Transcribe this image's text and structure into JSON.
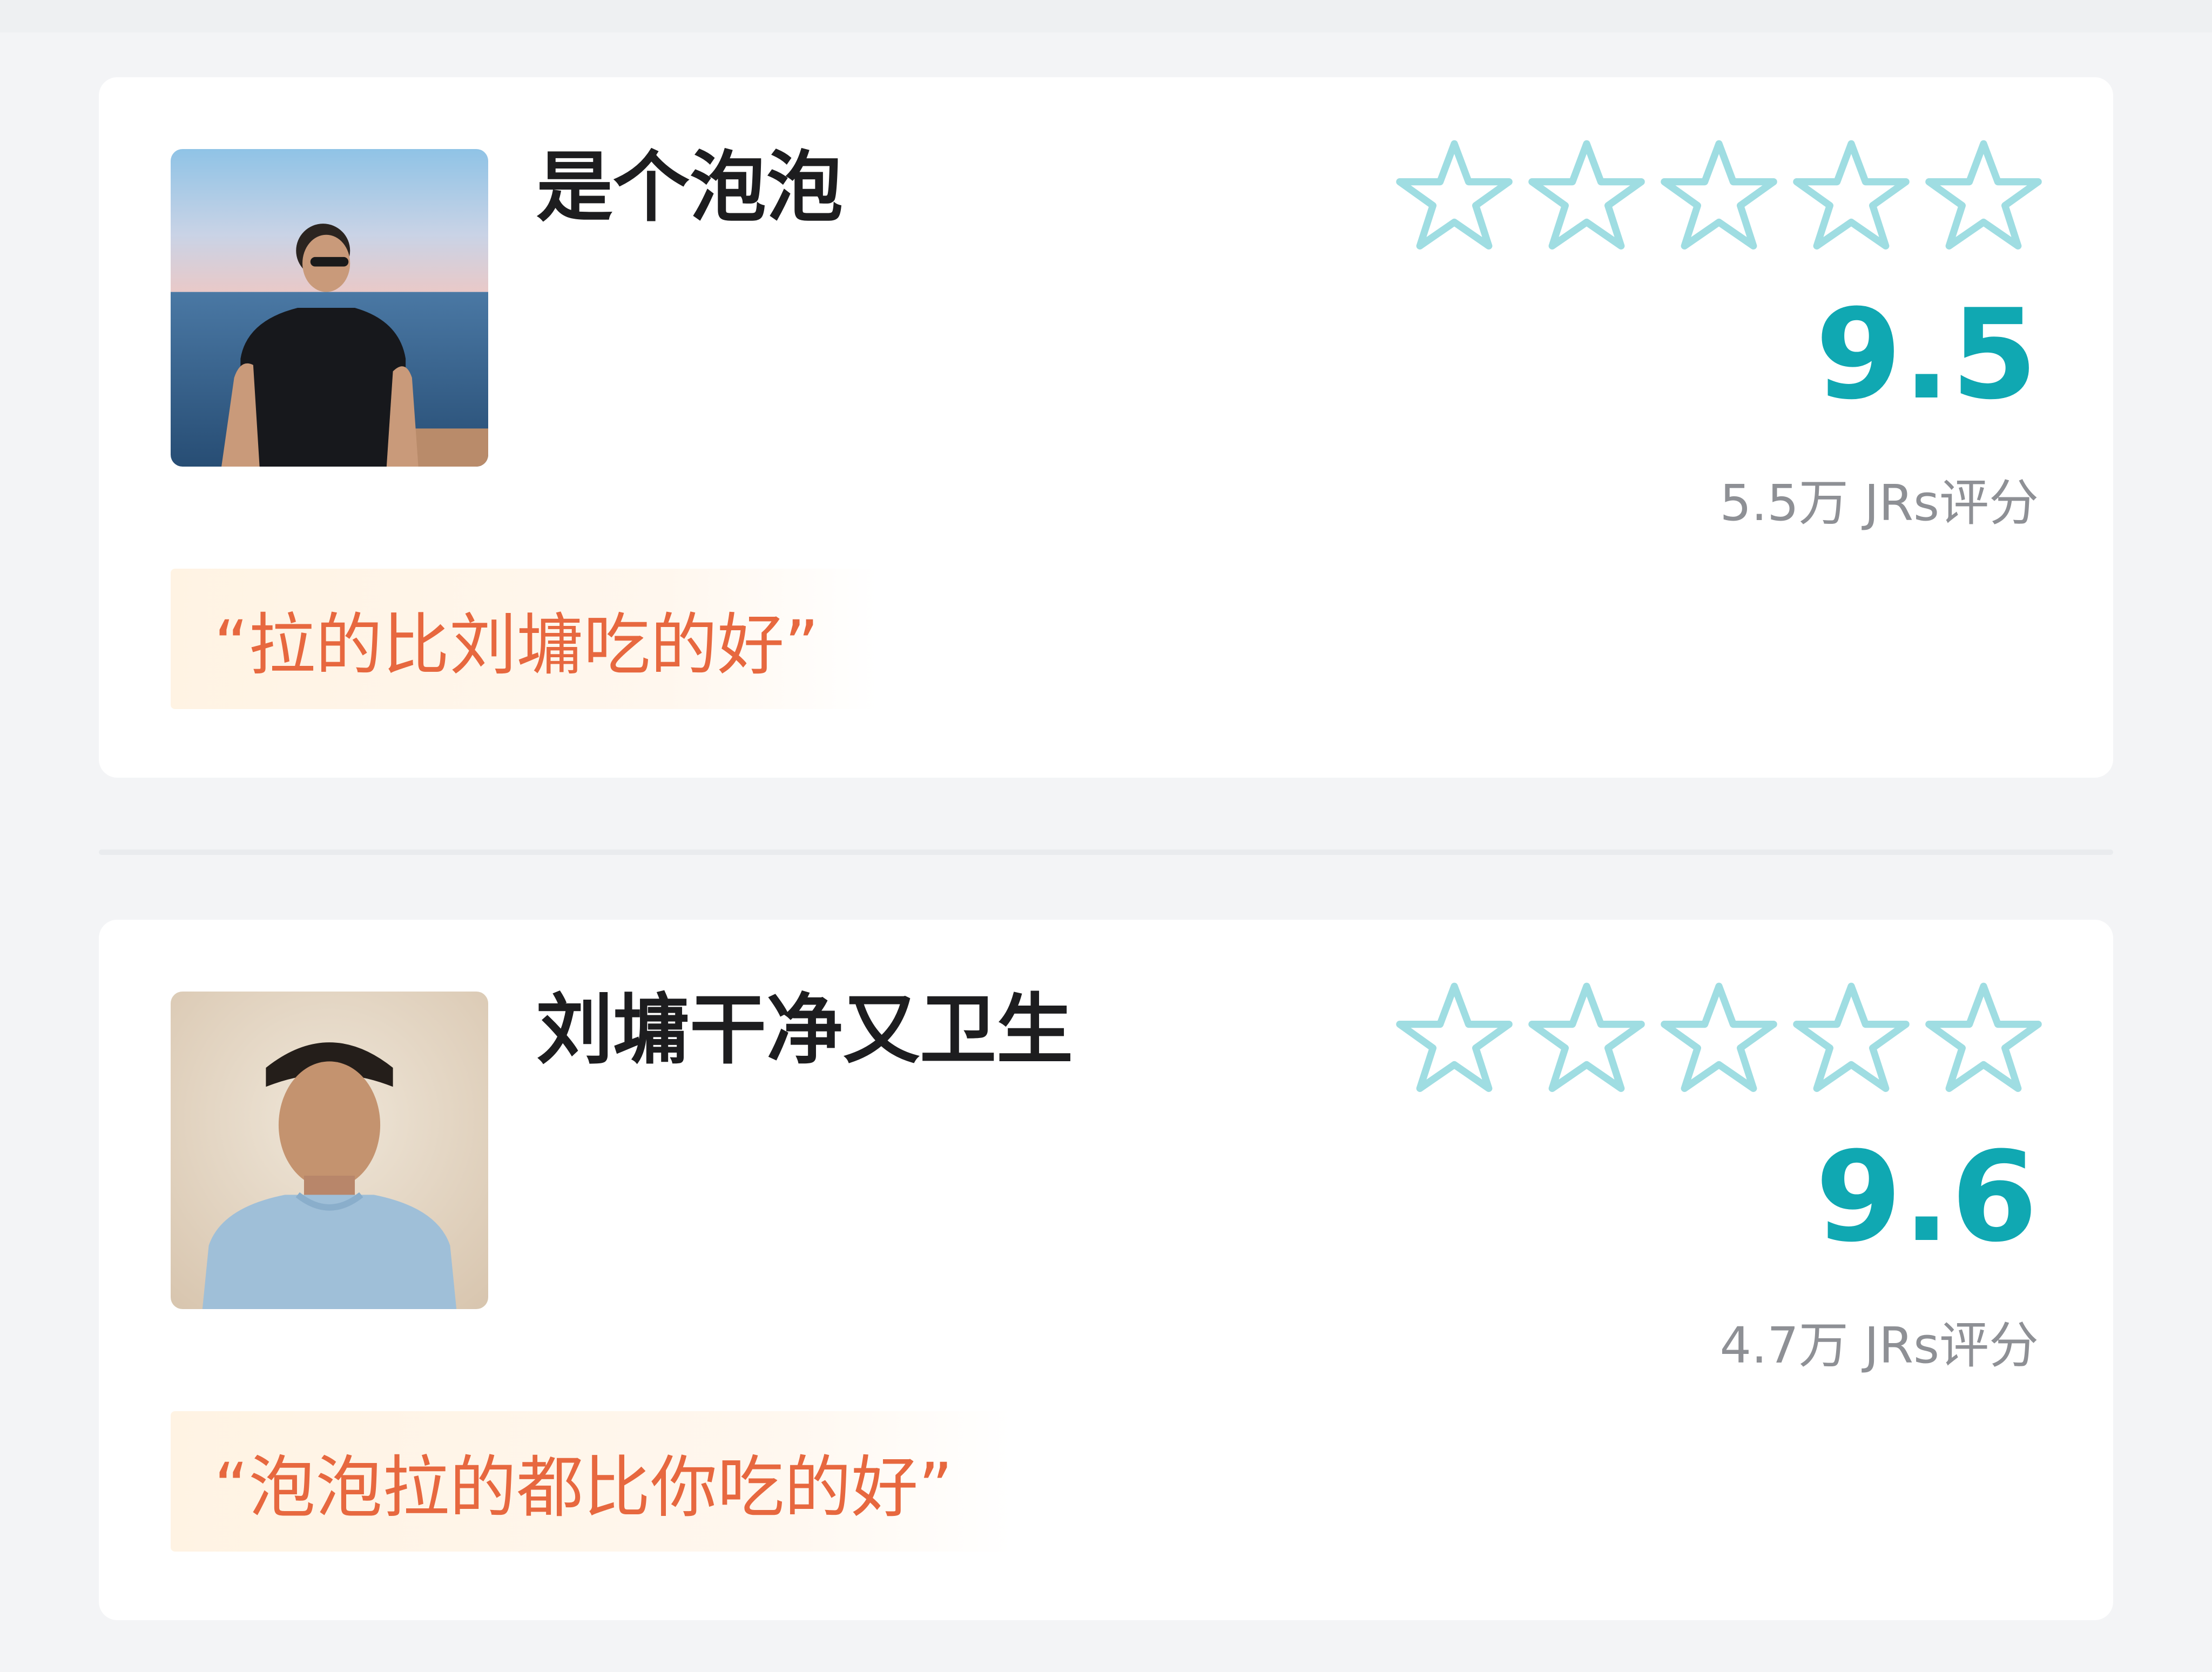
{
  "colors": {
    "page_bg": "#f3f4f6",
    "card_bg": "#ffffff",
    "score": "#10a8b2",
    "star_outline": "#9fdde2",
    "quote_text": "#e7683f",
    "quote_bg": "#fff3e3",
    "muted_text": "#8e9095"
  },
  "cards": [
    {
      "username": "是个泡泡",
      "avatar": "avatar-man-sunglasses-sea",
      "stars": {
        "total": 5,
        "filled": 0,
        "icon": "star-outline-icon"
      },
      "score": "9.5",
      "ratings_count": "5.5万 JRs评分",
      "quote": "“拉的比刘墉吃的好”"
    },
    {
      "username": "刘墉干净又卫生",
      "avatar": "avatar-man-blue-shirt",
      "stars": {
        "total": 5,
        "filled": 0,
        "icon": "star-outline-icon"
      },
      "score": "9.6",
      "ratings_count": "4.7万 JRs评分",
      "quote": "“泡泡拉的都比你吃的好”"
    }
  ]
}
